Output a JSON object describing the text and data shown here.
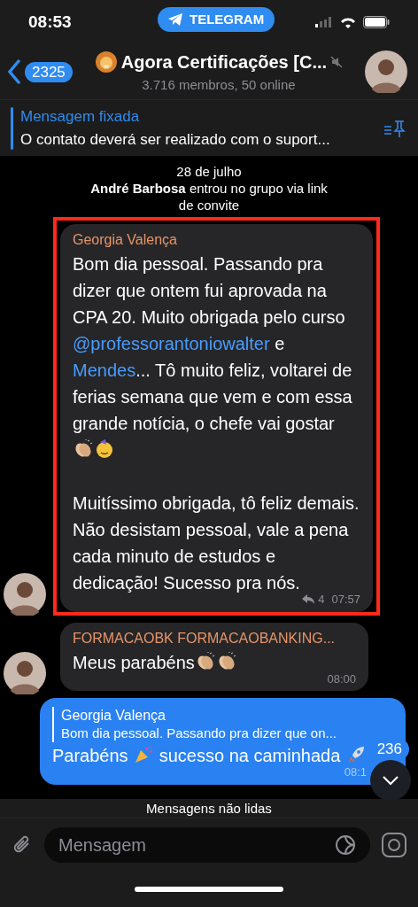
{
  "status_bar": {
    "time": "08:53",
    "app_pill": "TELEGRAM"
  },
  "header": {
    "back_count": "2325",
    "title": "Agora Certificações [C...",
    "subtitle": "3.716 membros, 50 online",
    "muted": true
  },
  "pinned": {
    "label": "Mensagem fixada",
    "text": "O contato deverá ser realizado com o suport..."
  },
  "service": {
    "date": "28 de julho",
    "actor": "André Barbosa",
    "action": "entrou no grupo via link de convite"
  },
  "messages": [
    {
      "kind": "incoming",
      "highlighted": true,
      "sender": "Georgia Valença",
      "segments": [
        {
          "kind": "text",
          "text": "Bom dia pessoal. Passando pra dizer que ontem fui aprovada na CPA 20. Muito obrigada pelo curso "
        },
        {
          "kind": "mention",
          "text": "@professorantoniowalter"
        },
        {
          "kind": "text",
          "text": " e "
        },
        {
          "kind": "mention",
          "text": "Mendes"
        },
        {
          "kind": "text",
          "text": "... Tô muito feliz, voltarei de ferias semana que vem e com essa grande notícia, o chefe vai gostar "
        },
        {
          "kind": "clapping_hands"
        },
        {
          "kind": "party_face"
        },
        {
          "kind": "text",
          "text": "\n\nMuitíssimo obrigada, tô feliz demais.\nNão desistam pessoal, vale a pena cada minuto de estudos e dedicação! Sucesso pra nós."
        }
      ],
      "forwards": "4",
      "time": "07:57"
    },
    {
      "kind": "incoming",
      "highlighted": false,
      "sender": "FORMACAOBK FORMACAOBANKING...",
      "segments": [
        {
          "kind": "text",
          "text": "Meus parabéns"
        },
        {
          "kind": "clapping_hands"
        },
        {
          "kind": "clapping_hands"
        }
      ],
      "time": "08:00"
    },
    {
      "kind": "outgoing",
      "reply": {
        "sender": "Georgia Valença",
        "text": "Bom dia pessoal. Passando pra dizer que on..."
      },
      "segments": [
        {
          "kind": "text",
          "text": "Parabéns "
        },
        {
          "kind": "party_popper"
        },
        {
          "kind": "text",
          "text": " sucesso na caminhada "
        },
        {
          "kind": "rocket"
        }
      ],
      "time": "08:1"
    }
  ],
  "scroll_badge": "236",
  "unread_bar": "Mensagens não lidas",
  "composer": {
    "placeholder": "Mensagem"
  }
}
